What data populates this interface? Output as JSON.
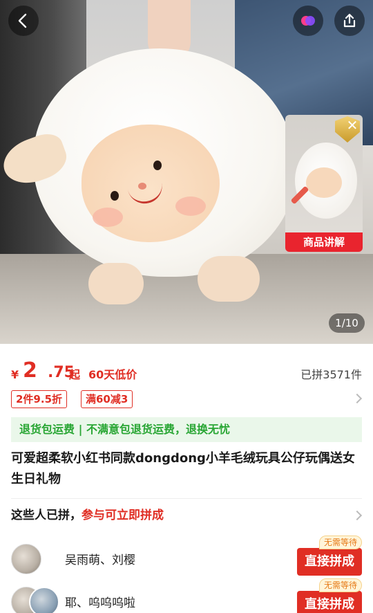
{
  "hero": {
    "page_indicator": "1/10",
    "video_label": "商品讲解",
    "video_close_glyph": "✕",
    "icons": {
      "back": "chevron-left-icon",
      "favorite": "heart-badge-icon",
      "share": "share-icon"
    }
  },
  "price": {
    "currency": "¥",
    "integer": "2",
    "decimal": ".75",
    "suffix": "起",
    "low_price_tag": "60天低价",
    "sold_count": "已拼3571件"
  },
  "coupons": [
    "2件9.5折",
    "满60减3"
  ],
  "guarantee": "退货包运费 | 不满意包退货运费，退换无忧",
  "title": "可爱超柔软小红书同款dongdong小羊毛绒玩具公仔玩偶送女生日礼物",
  "group": {
    "head_prefix": "这些人已拼，",
    "head_highlight": "参与可立即拼成",
    "rows": [
      {
        "names": "吴雨萌、刘樱",
        "badge": "无需等待",
        "button": "直接拼成"
      },
      {
        "names": "耶、呜呜呜啦",
        "badge": "无需等待",
        "button": "直接拼成"
      }
    ]
  },
  "colors": {
    "accent": "#e02e24",
    "guarantee_bg": "#eaf7ea",
    "guarantee_text": "#29a634"
  }
}
